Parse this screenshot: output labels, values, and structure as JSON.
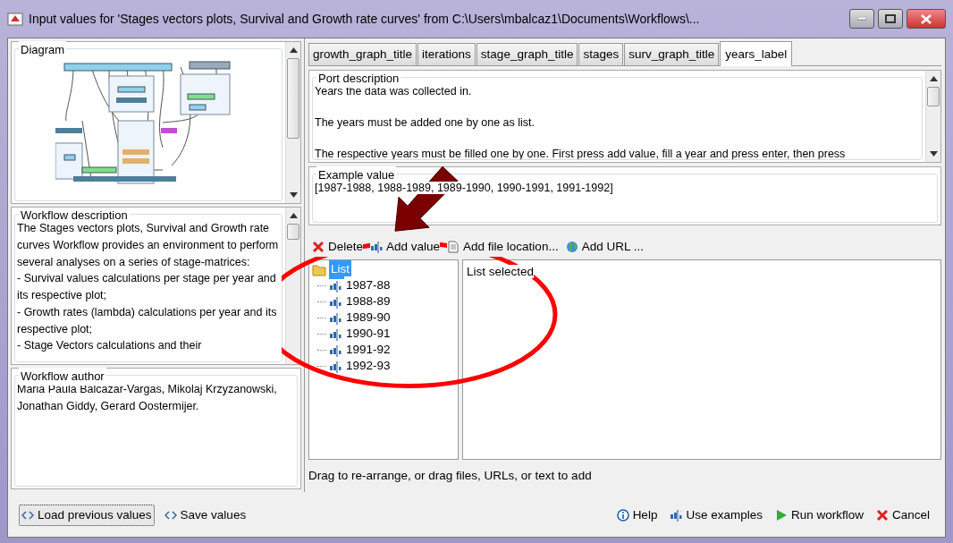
{
  "window": {
    "title": "Input values for 'Stages vectors plots, Survival and Growth rate curves' from C:\\Users\\mbalcaz1\\Documents\\Workflows\\..."
  },
  "diagram": {
    "title": "Diagram"
  },
  "description": {
    "title": "Workflow description",
    "paragraphs": [
      "The Stages vectors plots, Survival and Growth rate curves Workflow provides an environment to perform several analyses on a series of stage-matrices:",
      "- Survival values calculations per stage per year and its respective plot;",
      "- Growth rates (lambda) calculations per year and its respective plot;",
      "- Stage Vectors calculations and their"
    ]
  },
  "author": {
    "title": "Workflow author",
    "text": "Maria Paula Balcazar-Vargas, Mikolaj Krzyzanowski, Jonathan Giddy, Gerard Oostermijer."
  },
  "tabs": [
    {
      "label": "growth_graph_title",
      "selected": false
    },
    {
      "label": "iterations",
      "selected": false
    },
    {
      "label": "stage_graph_title",
      "selected": false
    },
    {
      "label": "stages",
      "selected": false
    },
    {
      "label": "surv_graph_title",
      "selected": false
    },
    {
      "label": "years_label",
      "selected": true
    }
  ],
  "port_description": {
    "title": "Port description",
    "paragraphs": [
      "Years the data was collected in.",
      "The years must be added one by one as list.",
      "The respective years must be filled one by one. First press add value, fill a year and press enter, then press"
    ]
  },
  "example": {
    "title": "Example value",
    "value": "[1987-1988, 1988-1989, 1989-1990, 1990-1991, 1991-1992]"
  },
  "toolbar": [
    {
      "kind": "delete",
      "label": "Delete"
    },
    {
      "kind": "text",
      "label": "Add value"
    },
    {
      "kind": "file",
      "label": "Add file location..."
    },
    {
      "kind": "globe",
      "label": "Add URL ..."
    }
  ],
  "tree": {
    "label": "List",
    "selected": true,
    "children": [
      {
        "label": "1987-88",
        "selected": false
      },
      {
        "label": "1988-89",
        "selected": false
      },
      {
        "label": "1989-90",
        "selected": false
      },
      {
        "label": "1990-91",
        "selected": false
      },
      {
        "label": "1991-92",
        "selected": false
      },
      {
        "label": "1992-93",
        "selected": false
      }
    ]
  },
  "detail": "List selected",
  "hint": "Drag to re-arrange, or drag files, URLs, or text to add",
  "footer_left": [
    {
      "kind": "arrows",
      "label": "Load previous values",
      "focused": true
    },
    {
      "kind": "arrows",
      "label": "Save values",
      "focused": false
    }
  ],
  "footer_right": [
    {
      "kind": "info",
      "label": "Help"
    },
    {
      "kind": "text",
      "label": "Use examples"
    },
    {
      "kind": "run",
      "label": "Run workflow"
    },
    {
      "kind": "cancel",
      "label": "Cancel"
    }
  ]
}
